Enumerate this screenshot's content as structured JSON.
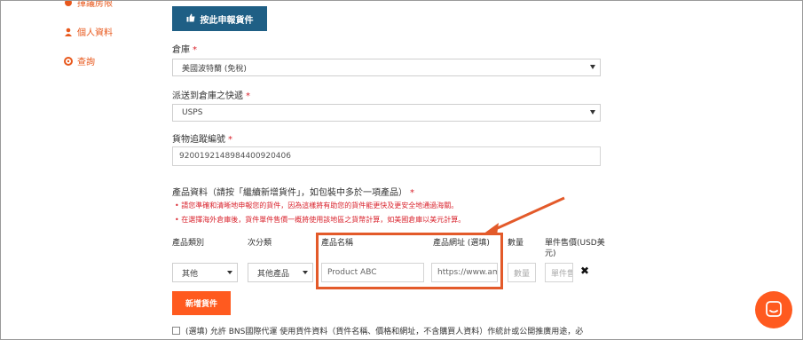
{
  "sidebar": {
    "items": [
      {
        "label": "揮議房限",
        "icon": "gear-icon"
      },
      {
        "label": "個人資料",
        "icon": "user-icon"
      },
      {
        "label": "查詢",
        "icon": "lifebuoy-icon"
      }
    ]
  },
  "submit_button": {
    "label": "按此申報貨件",
    "icon": "thumbs-up-icon"
  },
  "warehouse": {
    "label": "倉庫",
    "required": "*",
    "value": "美國波特蘭 (免稅)"
  },
  "courier": {
    "label": "派送到倉庫之快遞",
    "required": "*",
    "value": "USPS"
  },
  "tracking": {
    "label": "貨物追蹤編號",
    "required": "*",
    "value": "9200192148984400920406"
  },
  "products": {
    "label": "產品資料（請按「繼續新增貨件」，如包裝中多於一項產品）",
    "required": "*",
    "notes": [
      "• 請您準確和清晰地申報您的貨件，因為這樣將有助您的貨件能更快及更安全地通過海關。",
      "• 在選擇海外倉庫後，貨件單件售價一概將使用該地區之貨幣計算，如美國倉庫以美元計算。"
    ],
    "columns": {
      "category": "產品類別",
      "subcategory": "次分類",
      "name": "產品名稱",
      "url": "產品網址 (選填)",
      "quantity": "數量",
      "unit_price": "單件售價(USD美元)"
    },
    "row": {
      "category": "其他",
      "subcategory": "其他產品",
      "name": "Product ABC",
      "url": "https://www.amazon",
      "quantity_placeholder": "數量",
      "price_placeholder": "單件售"
    },
    "remove_icon": "close-icon"
  },
  "add_button": {
    "label": "新增貨件"
  },
  "consent": {
    "text": "(選填) 允許 BNS國際代運 使用貨件資料（貨件名稱、價格和網址，不含購買人資料）作統計或公開推廣用途，必"
  },
  "chat": {
    "icon": "chat-icon"
  },
  "colors": {
    "accent": "#ff5a1f",
    "primary": "#1f5f85",
    "required": "#d9232d",
    "highlight": "#e35a2a"
  }
}
